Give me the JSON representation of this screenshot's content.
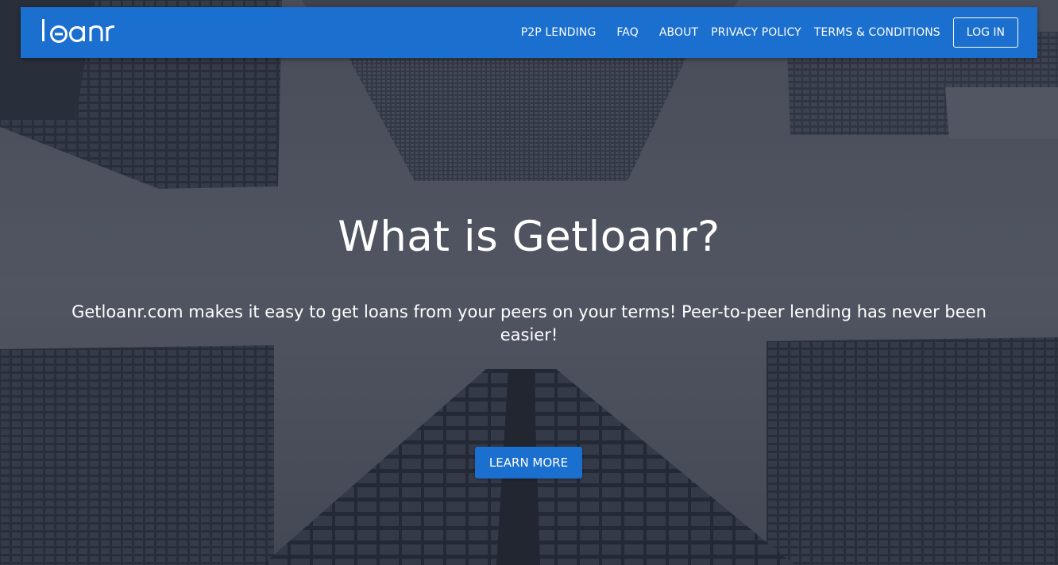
{
  "brand": {
    "logo_text": "loanr",
    "color": "#1b6fce"
  },
  "nav": {
    "items": [
      {
        "label": "P2P LENDING"
      },
      {
        "label": "FAQ"
      },
      {
        "label": "ABOUT"
      },
      {
        "label": "PRIVACY POLICY"
      },
      {
        "label": "TERMS & CONDITIONS"
      }
    ],
    "login_label": "LOG IN"
  },
  "hero": {
    "title": "What is Getloanr?",
    "subtitle": "Getloanr.com makes it easy to get loans from your peers on your terms! Peer-to-peer lending has never been easier!",
    "cta_label": "LEARN MORE"
  },
  "icons": {
    "logo": "loanr-logo-icon"
  }
}
